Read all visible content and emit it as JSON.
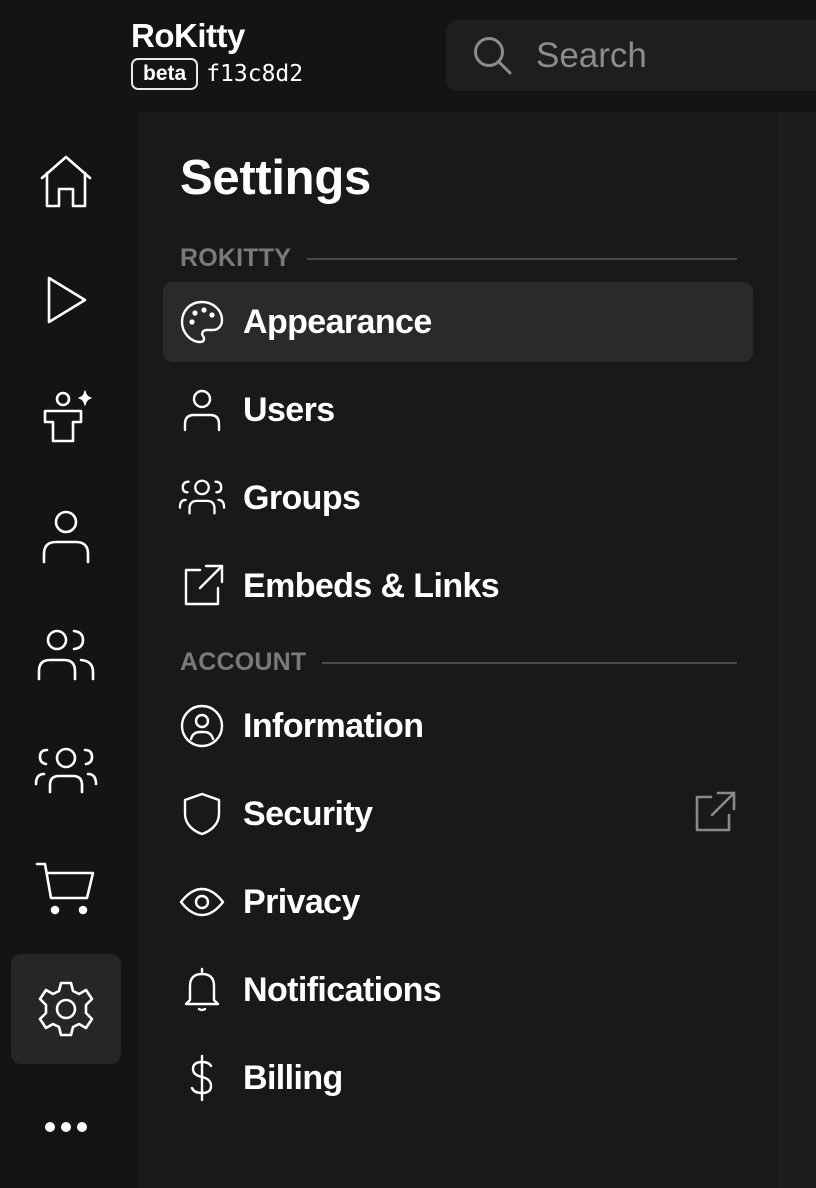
{
  "header": {
    "app_name": "RoKitty",
    "badge": "beta",
    "commit": "f13c8d2",
    "search_placeholder": "Search"
  },
  "rail": {
    "items": [
      {
        "name": "home",
        "icon": "home-icon"
      },
      {
        "name": "play",
        "icon": "play-icon"
      },
      {
        "name": "avatar",
        "icon": "avatar-sparkle-icon"
      },
      {
        "name": "profile",
        "icon": "user-icon"
      },
      {
        "name": "friends",
        "icon": "users-icon"
      },
      {
        "name": "groups",
        "icon": "group-icon"
      },
      {
        "name": "shop",
        "icon": "cart-icon"
      },
      {
        "name": "settings",
        "icon": "gear-icon",
        "active": true
      },
      {
        "name": "more",
        "icon": "more-icon"
      }
    ]
  },
  "settings": {
    "title": "Settings",
    "sections": [
      {
        "label": "ROKITTY",
        "items": [
          {
            "label": "Appearance",
            "icon": "palette-icon",
            "active": true
          },
          {
            "label": "Users",
            "icon": "user-icon"
          },
          {
            "label": "Groups",
            "icon": "group-icon"
          },
          {
            "label": "Embeds & Links",
            "icon": "external-link-icon"
          }
        ]
      },
      {
        "label": "ACCOUNT",
        "items": [
          {
            "label": "Information",
            "icon": "user-circle-icon"
          },
          {
            "label": "Security",
            "icon": "shield-icon",
            "external": true
          },
          {
            "label": "Privacy",
            "icon": "eye-icon"
          },
          {
            "label": "Notifications",
            "icon": "bell-icon"
          },
          {
            "label": "Billing",
            "icon": "dollar-icon"
          }
        ]
      }
    ]
  },
  "colors": {
    "background": "#141414",
    "panel": "#191919",
    "active_item": "#2a2a2a",
    "section_label": "#7a7a7a",
    "text": "#ffffff"
  }
}
